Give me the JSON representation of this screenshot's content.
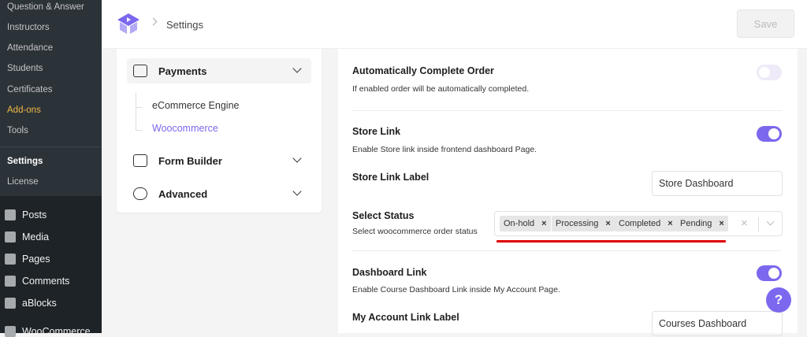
{
  "wp_sidebar": {
    "submenu": [
      "Question & Answer",
      "Instructors",
      "Attendance",
      "Students",
      "Certificates",
      "Add-ons",
      "Tools",
      "Settings",
      "License"
    ],
    "menu": [
      {
        "label": "Posts",
        "icon": "pin-icon"
      },
      {
        "label": "Media",
        "icon": "media-icon"
      },
      {
        "label": "Pages",
        "icon": "pages-icon"
      },
      {
        "label": "Comments",
        "icon": "comment-icon"
      },
      {
        "label": "aBlocks",
        "icon": "ablocks-icon"
      },
      {
        "label": "WooCommerce",
        "icon": "woo-icon"
      }
    ]
  },
  "header": {
    "breadcrumb": "Settings",
    "save": "Save"
  },
  "settings_nav": {
    "payments": "Payments",
    "sub": [
      "eCommerce Engine",
      "Woocommerce"
    ],
    "form_builder": "Form Builder",
    "advanced": "Advanced"
  },
  "panel": {
    "auto_complete": {
      "title": "Automatically Complete Order",
      "desc": "If enabled order will be automatically completed.",
      "enabled": false
    },
    "store_link": {
      "title": "Store Link",
      "desc": "Enable Store link inside frontend dashboard Page.",
      "enabled": true
    },
    "store_link_label": {
      "title": "Store Link Label",
      "value": "Store Dashboard"
    },
    "select_status": {
      "title": "Select Status",
      "desc": "Select woocommerce order status",
      "tags": [
        "On-hold",
        "Processing",
        "Completed",
        "Pending"
      ]
    },
    "dashboard_link": {
      "title": "Dashboard Link",
      "desc": "Enable Course Dashboard Link inside My Account Page.",
      "enabled": true
    },
    "my_account_label": {
      "title": "My Account Link Label",
      "value": "Courses Dashboard"
    }
  },
  "help": "?",
  "colors": {
    "accent": "#7b68ee",
    "addons": "#f0b849",
    "red_underline": "#e00000"
  }
}
